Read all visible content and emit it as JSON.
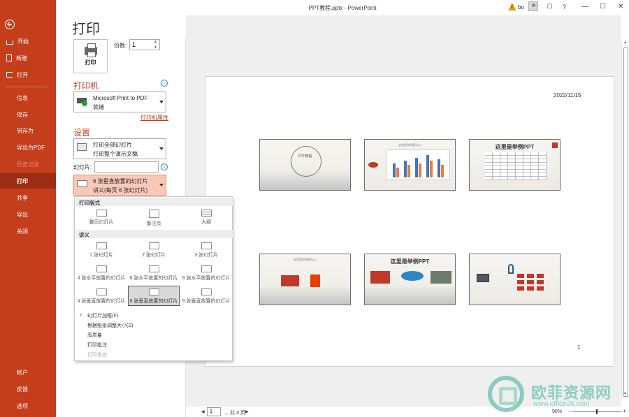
{
  "window": {
    "title": "PPT教程.pptx - PowerPoint",
    "user": "bo",
    "help": "?"
  },
  "nav": {
    "items": [
      {
        "label": "开始"
      },
      {
        "label": "新建"
      },
      {
        "label": "打开"
      },
      {
        "label": "信息"
      },
      {
        "label": "保存"
      },
      {
        "label": "另存为"
      },
      {
        "label": "导出为PDF"
      },
      {
        "label": "历史记录"
      },
      {
        "label": "打印"
      },
      {
        "label": "共享"
      },
      {
        "label": "导出"
      },
      {
        "label": "关闭"
      },
      {
        "label": "帐户"
      },
      {
        "label": "反馈"
      },
      {
        "label": "选项"
      }
    ]
  },
  "print": {
    "title": "打印",
    "button_label": "打印",
    "copies_label": "份数:",
    "copies_value": "1",
    "printer_heading": "打印机",
    "printer_name": "Microsoft Print to PDF",
    "printer_status": "就绪",
    "printer_properties": "打印机属性",
    "settings_heading": "设置",
    "range_line1": "打印全部幻灯片",
    "range_line2": "打印整个演示文稿",
    "slides_label": "幻灯片:",
    "layout_line1": "6 张垂直放置的幻灯片",
    "layout_line2": "讲义(每页 6 张幻灯片)"
  },
  "popup": {
    "header_layout": "打印版式",
    "header_handouts": "讲义",
    "layouts": [
      "整页幻灯片",
      "备注页",
      "大纲"
    ],
    "handouts": [
      "1 张幻灯片",
      "2 张幻灯片",
      "3 张幻灯片",
      "4 张水平放置的幻灯片",
      "6 张水平放置的幻灯片",
      "9 张水平放置的幻灯片",
      "4 张垂直放置的幻灯片",
      "6 张垂直放置的幻灯片",
      "9 张垂直放置的幻灯片"
    ],
    "selected_index": 7,
    "options": [
      {
        "label": "幻灯片加框(F)",
        "checked": true
      },
      {
        "label": "根据纸张调整大小(S)",
        "checked": false
      },
      {
        "label": "高质量",
        "checked": false
      },
      {
        "label": "打印批注",
        "checked": false
      },
      {
        "label": "打印墨迹",
        "checked": false,
        "disabled": true
      }
    ]
  },
  "preview": {
    "date": "2022/11/15",
    "page_number": "1",
    "slides": [
      {
        "title": "PPT教程"
      },
      {
        "title": "这里是举例表头(2)"
      },
      {
        "title": "这里是举例PPT"
      },
      {
        "title": "这里是举例表头(1)"
      },
      {
        "title": "这里是举例PPT"
      },
      {
        "title": ""
      }
    ]
  },
  "status": {
    "page_input": "1",
    "page_total": "，共 3 页",
    "zoom": "90%"
  },
  "watermark": {
    "text": "欧菲资源网",
    "url": "www.office26.com"
  },
  "colors": {
    "accent": "#c43e1c",
    "active_nav": "#9a2d13"
  }
}
